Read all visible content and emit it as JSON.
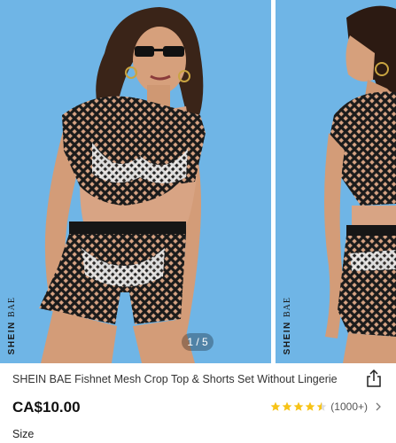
{
  "gallery": {
    "pager_text": "1 / 5",
    "watermark_brand": "SHEIN",
    "watermark_sub": "BAE",
    "background_color": "#6fb5e6"
  },
  "product": {
    "title": "SHEIN BAE Fishnet Mesh Crop Top & Shorts Set Without Lingerie",
    "price": "CA$10.00",
    "rating_stars": 4.5,
    "review_count": "(1000+)",
    "size_label": "Size"
  },
  "icons": {
    "share": "share-icon",
    "star": "star-icon",
    "chevron": "chevron-right-icon"
  },
  "colors": {
    "star": "#f7c317",
    "price": "#111111"
  }
}
